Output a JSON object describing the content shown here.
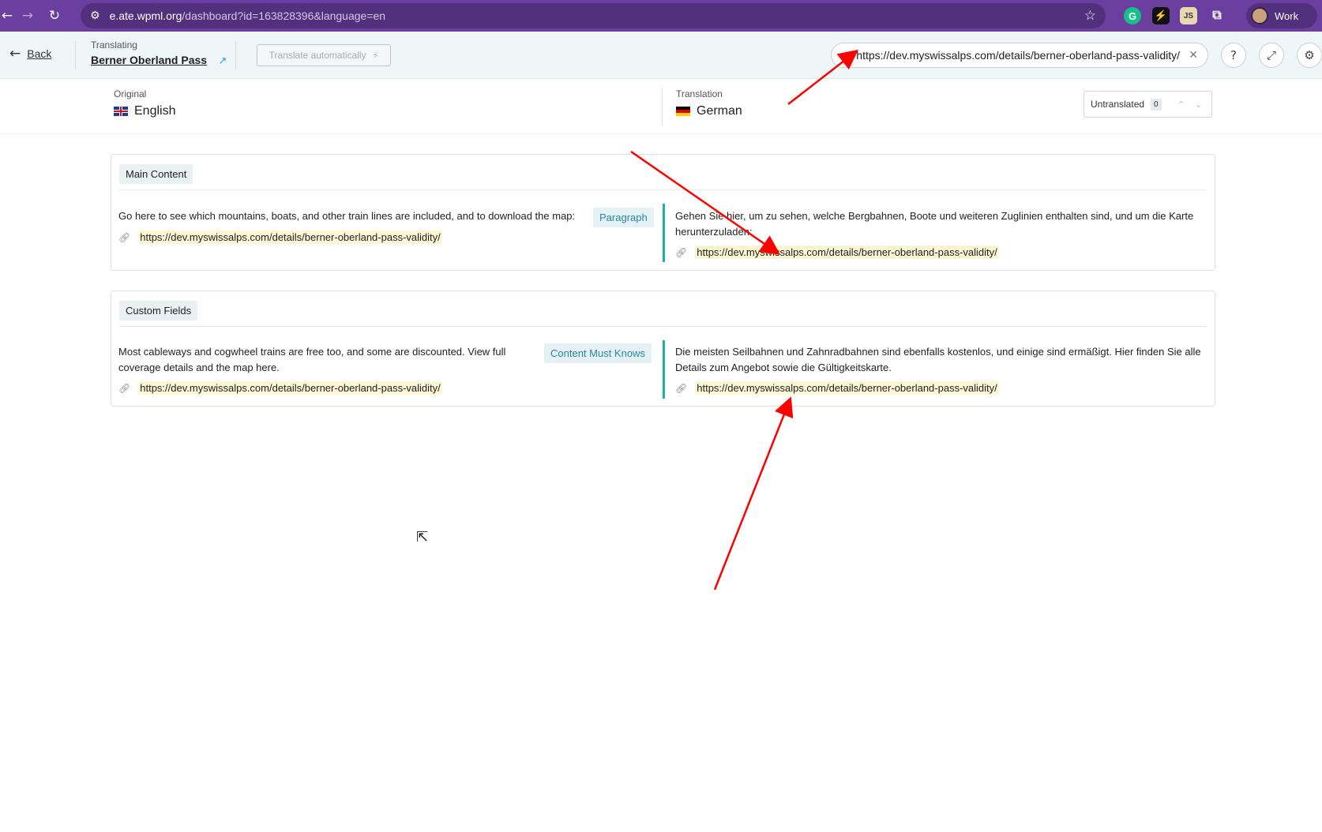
{
  "browser": {
    "url_host": "e.ate.wpml.org",
    "url_path": "/dashboard?id=163828396&language=en",
    "profile_label": "Work"
  },
  "toolbar": {
    "back_label": "Back",
    "translating_caption": "Translating",
    "document_title": "Berner Oberland Pass",
    "translate_auto_label": "Translate automatically",
    "search_value": "https://dev.myswissalps.com/details/berner-oberland-pass-validity/"
  },
  "languages": {
    "original_caption": "Original",
    "original_lang": "English",
    "translation_caption": "Translation",
    "translation_lang": "German",
    "untranslated_label": "Untranslated",
    "untranslated_count": "0"
  },
  "sections": [
    {
      "label": "Main Content",
      "source_text": "Go here to see which mountains, boats, and other train lines are included, and to download the map:",
      "source_url": "https://dev.myswissalps.com/details/berner-oberland-pass-validity/",
      "tag": "Paragraph",
      "target_text_line1": "Gehen Sie hier, um zu sehen, welche Bergbahnen, Boote und weiteren Zuglinien enthalten sind, und um die Karte",
      "target_text_line2": "herunterzuladen:",
      "target_url": "https://dev.myswissalps.com/details/berner-oberland-pass-validity/"
    },
    {
      "label": "Custom Fields",
      "source_text_line1": "Most cableways and cogwheel trains are free too, and some are discounted. View full",
      "source_text_line2": "coverage details and the map here.",
      "source_url": "https://dev.myswissalps.com/details/berner-oberland-pass-validity/",
      "tag": "Content Must Knows",
      "target_text_line1": "Die meisten Seilbahnen und Zahnradbahnen sind ebenfalls kostenlos, und einige sind ermäßigt. Hier finden Sie alle",
      "target_text_line2": "Details zum Angebot sowie die Gültigkeitskarte.",
      "target_url": "https://dev.myswissalps.com/details/berner-oberland-pass-validity/"
    }
  ],
  "colors": {
    "browser_bar": "#6a3fa0",
    "toolbar_bg": "#eef6f8",
    "teal_accent": "#1bb39c",
    "url_highlight": "#fdf6d4",
    "annotation_arrow": "#ff0000"
  },
  "icons": [
    "back-arrow-icon",
    "forward-arrow-icon",
    "reload-icon",
    "site-settings-icon",
    "star-icon",
    "grammarly-icon",
    "external-link-icon",
    "bolt-icon",
    "search-icon",
    "clear-icon",
    "help-icon",
    "expand-icon",
    "gear-icon",
    "link-icon",
    "chevron-up-icon",
    "chevron-down-icon",
    "cursor-icon"
  ]
}
